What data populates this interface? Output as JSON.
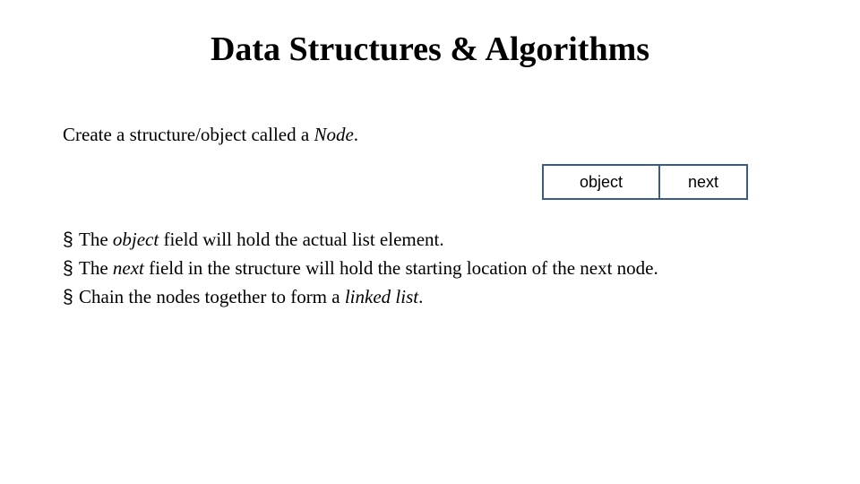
{
  "title": "Data Structures & Algorithms",
  "intro": {
    "prefix": "Create a structure/object called a ",
    "node": "Node",
    "suffix": "."
  },
  "node_diagram": {
    "object_label": "object",
    "next_label": "next"
  },
  "bullets": {
    "marker": "§",
    "items": [
      {
        "before": "The ",
        "em": "object",
        "after": " field will hold the actual list element."
      },
      {
        "before": "The ",
        "em": "next",
        "after": " field in the structure will hold the starting location of the next node."
      },
      {
        "before": "Chain the nodes together to form a ",
        "em": "linked list",
        "after": "."
      }
    ]
  }
}
